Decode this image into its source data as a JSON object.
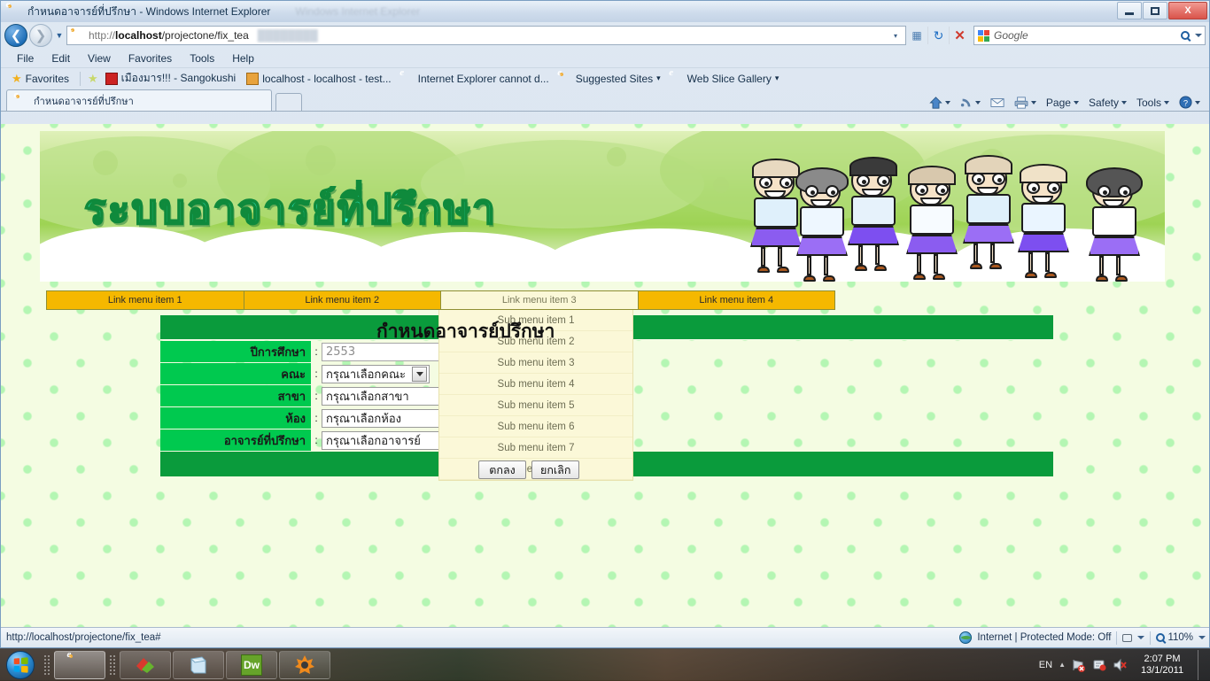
{
  "window": {
    "title": "กำหนดอาจารย์ที่ปรึกษา - Windows Internet Explorer",
    "ghost_title": "Windows Internet Explorer",
    "minimize_label": "Minimize",
    "maximize_label": "Maximize",
    "close_label": "X"
  },
  "address_bar": {
    "url_protocol": "http://",
    "url_host": "localhost",
    "url_path": "/projectone/fix_tea",
    "url_full": "http://localhost/projectone/fix_tea",
    "compat_title": "Compatibility View",
    "refresh_title": "Refresh",
    "stop_title": "Stop",
    "stop_glyph": "✕",
    "refresh_glyph": "↻",
    "dropdown_glyph": "▾"
  },
  "search": {
    "placeholder": "Google",
    "provider": "Google"
  },
  "menu": {
    "items": [
      "File",
      "Edit",
      "View",
      "Favorites",
      "Tools",
      "Help"
    ]
  },
  "favorites_bar": {
    "label": "Favorites",
    "items": [
      {
        "label": "เมืองมาร!!! - Sangokushi",
        "icon": "sangokushi-icon"
      },
      {
        "label": "localhost - localhost - test...",
        "icon": "phpmyadmin-icon"
      },
      {
        "label": "Internet Explorer cannot d...",
        "icon": "ie-icon"
      },
      {
        "label": "Suggested Sites",
        "icon": "ie-icon",
        "caret": "▾"
      },
      {
        "label": "Web Slice Gallery",
        "icon": "ie-icon",
        "caret": "▾"
      }
    ]
  },
  "tabs": {
    "active": "กำหนดอาจารย์ที่ปรึกษา",
    "new_tab_label": ""
  },
  "command_bar": {
    "items": [
      {
        "label": "",
        "icon": "home-icon",
        "caret": "▾"
      },
      {
        "label": "",
        "icon": "feeds-icon",
        "caret": "▾"
      },
      {
        "label": "",
        "icon": "mail-icon",
        "caret": ""
      },
      {
        "label": "",
        "icon": "print-icon",
        "caret": "▾"
      },
      {
        "label": "Page",
        "icon": "",
        "caret": "▾"
      },
      {
        "label": "Safety",
        "icon": "",
        "caret": "▾"
      },
      {
        "label": "Tools",
        "icon": "",
        "caret": "▾"
      },
      {
        "label": "",
        "icon": "help-icon",
        "caret": "▾"
      }
    ]
  },
  "page": {
    "banner_title": "ระบบอาจารย์ที่ปรึกษา",
    "heading": "กำหนดอาจารย์ปรึกษา",
    "nav_items": [
      "Link menu item 1",
      "Link menu item 2",
      "Link menu item 3",
      "Link menu item 4"
    ],
    "open_nav_index": 2,
    "sub_items": [
      "Sub menu item 1",
      "Sub menu item 2",
      "Sub menu item 3",
      "Sub menu item 4",
      "Sub menu item 5",
      "Sub menu item 6",
      "Sub menu item 7",
      "Sub menu item 8"
    ],
    "form": {
      "colon": ":",
      "fields": [
        {
          "label": "ปีการศึกษา",
          "type": "text",
          "value": "2553",
          "width": "text"
        },
        {
          "label": "คณะ",
          "type": "select",
          "value": "กรุณาเลือกคณะ",
          "width": "sel-w1"
        },
        {
          "label": "สาขา",
          "type": "select",
          "value": "กรุณาเลือกสาขา",
          "width": "sel-w2"
        },
        {
          "label": "ห้อง",
          "type": "select",
          "value": "กรุณาเลือกห้อง",
          "width": "sel-w3"
        },
        {
          "label": "อาจารย์ที่ปรึกษา",
          "type": "select",
          "value": "กรุณาเลือกอาจารย์",
          "width": "sel-w3"
        }
      ],
      "submit_label": "ตกลง",
      "cancel_label": "ยกเลิก"
    },
    "colors": {
      "header_green": "#0a9b3c",
      "label_green": "#00c94f",
      "menu_yellow": "#f5b800",
      "submenu_cream": "#fbf8d8",
      "page_bg": "#f4fce2"
    }
  },
  "status_bar": {
    "url": "http://localhost/projectone/fix_tea#",
    "zone": "Internet | Protected Mode: Off",
    "zoom": "110%",
    "zone_caret": "▾",
    "zoom_caret": "▾"
  },
  "taskbar": {
    "buttons": [
      {
        "name": "internet-explorer",
        "label": "",
        "active": true
      },
      {
        "name": "app-red-green",
        "label": "",
        "active": false
      },
      {
        "name": "notepad-like",
        "label": "",
        "active": false
      },
      {
        "name": "dreamweaver",
        "label": "Dw",
        "active": false
      },
      {
        "name": "avast-antivirus",
        "label": "",
        "active": false
      }
    ],
    "tray": {
      "language": "EN",
      "expand_glyph": "▲",
      "time": "2:07 PM",
      "date": "13/1/2011"
    }
  }
}
